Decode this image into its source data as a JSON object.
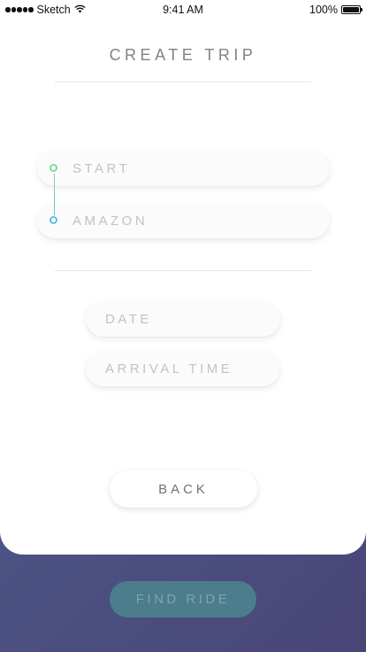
{
  "status_bar": {
    "carrier": "Sketch",
    "time": "9:41 AM",
    "battery": "100%"
  },
  "screen": {
    "title": "CREATE TRIP"
  },
  "route": {
    "start_placeholder": "START",
    "destination_placeholder": "AMAZON"
  },
  "schedule": {
    "date_placeholder": "DATE",
    "arrival_placeholder": "ARRIVAL TIME"
  },
  "actions": {
    "back_label": "BACK",
    "find_label": "FIND RIDE"
  },
  "colors": {
    "start_dot": "#7fd8a0",
    "end_dot": "#5cc3e0",
    "background_gradient": [
      "#4a5a8c",
      "#4a4577"
    ],
    "find_button": "#4b7d8c"
  }
}
